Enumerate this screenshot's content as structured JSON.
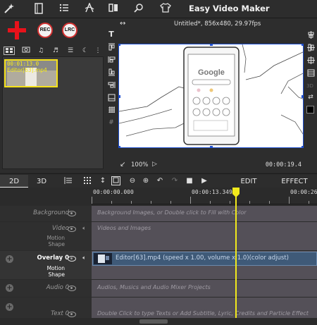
{
  "app": {
    "title": "Easy Video Maker",
    "toolbar_icons": [
      "magic-wand-icon",
      "book-icon",
      "list-icon",
      "text-path-icon",
      "split-icon",
      "search-icon",
      "tshirt-icon"
    ]
  },
  "media": {
    "add_icon": "plus-icon",
    "rec_label": "REC",
    "lrc_label": "LRC",
    "tabs": [
      "grid-tab-icon",
      "camera-tab-icon",
      "music-tab-icon",
      "music2-tab-icon",
      "list-tab-icon",
      "moon-tab-icon",
      "more-tab-icon"
    ],
    "items": [
      {
        "time": "00:01:13.0",
        "name": "Editor[63].mp4"
      }
    ]
  },
  "preview": {
    "header": "Untitled*, 856x480, 29.97fps",
    "zoom": "100%",
    "time": "00:00:19.4"
  },
  "tools_left": [
    "text-icon",
    "align-top-icon",
    "align-left-icon",
    "align-bottom-icon",
    "align-right-icon",
    "distribute-icon",
    "frame-icon",
    "grid-icon",
    "hash-icon"
  ],
  "tools_right": [
    "align-h-icon",
    "align-center-icon",
    "align-v-icon",
    "layout-icon",
    "3d-icon",
    "flip-icon",
    "color-swatch-icon"
  ],
  "timeline": {
    "tab_2d": "2D",
    "tab_3d": "3D",
    "edit_label": "EDIT",
    "effect_label": "EFFECT",
    "ruler": [
      "00:00:00.000",
      "00:00:13.349",
      "00:00:26."
    ],
    "tracks": {
      "background": {
        "name": "Background",
        "hint": "Background Images, or Double click to Fill with Color"
      },
      "video": {
        "name": "Video",
        "sub1": "Motion",
        "sub2": "Shape",
        "hint": "Videos and Images"
      },
      "overlay": {
        "name": "Overlay 0",
        "sub1": "Motion",
        "sub2": "Shape",
        "clip": "Editor[63].mp4  (speed x 1.00, volume x 1.0)(color adjust)"
      },
      "audio": {
        "name": "Audio 0",
        "hint": "Audios, Musics and Audio Mixer Projects"
      },
      "text": {
        "name": "Text 0",
        "hint": "Double Click to type Texts or Add Subtitle, Lyric, Credits and Particle Effect"
      }
    }
  },
  "colors": {
    "accent_yellow": "#f1e91c",
    "selection_blue": "#1e4fd0",
    "plus_red": "#e8121b",
    "clip_blue": "#3f5a78"
  }
}
